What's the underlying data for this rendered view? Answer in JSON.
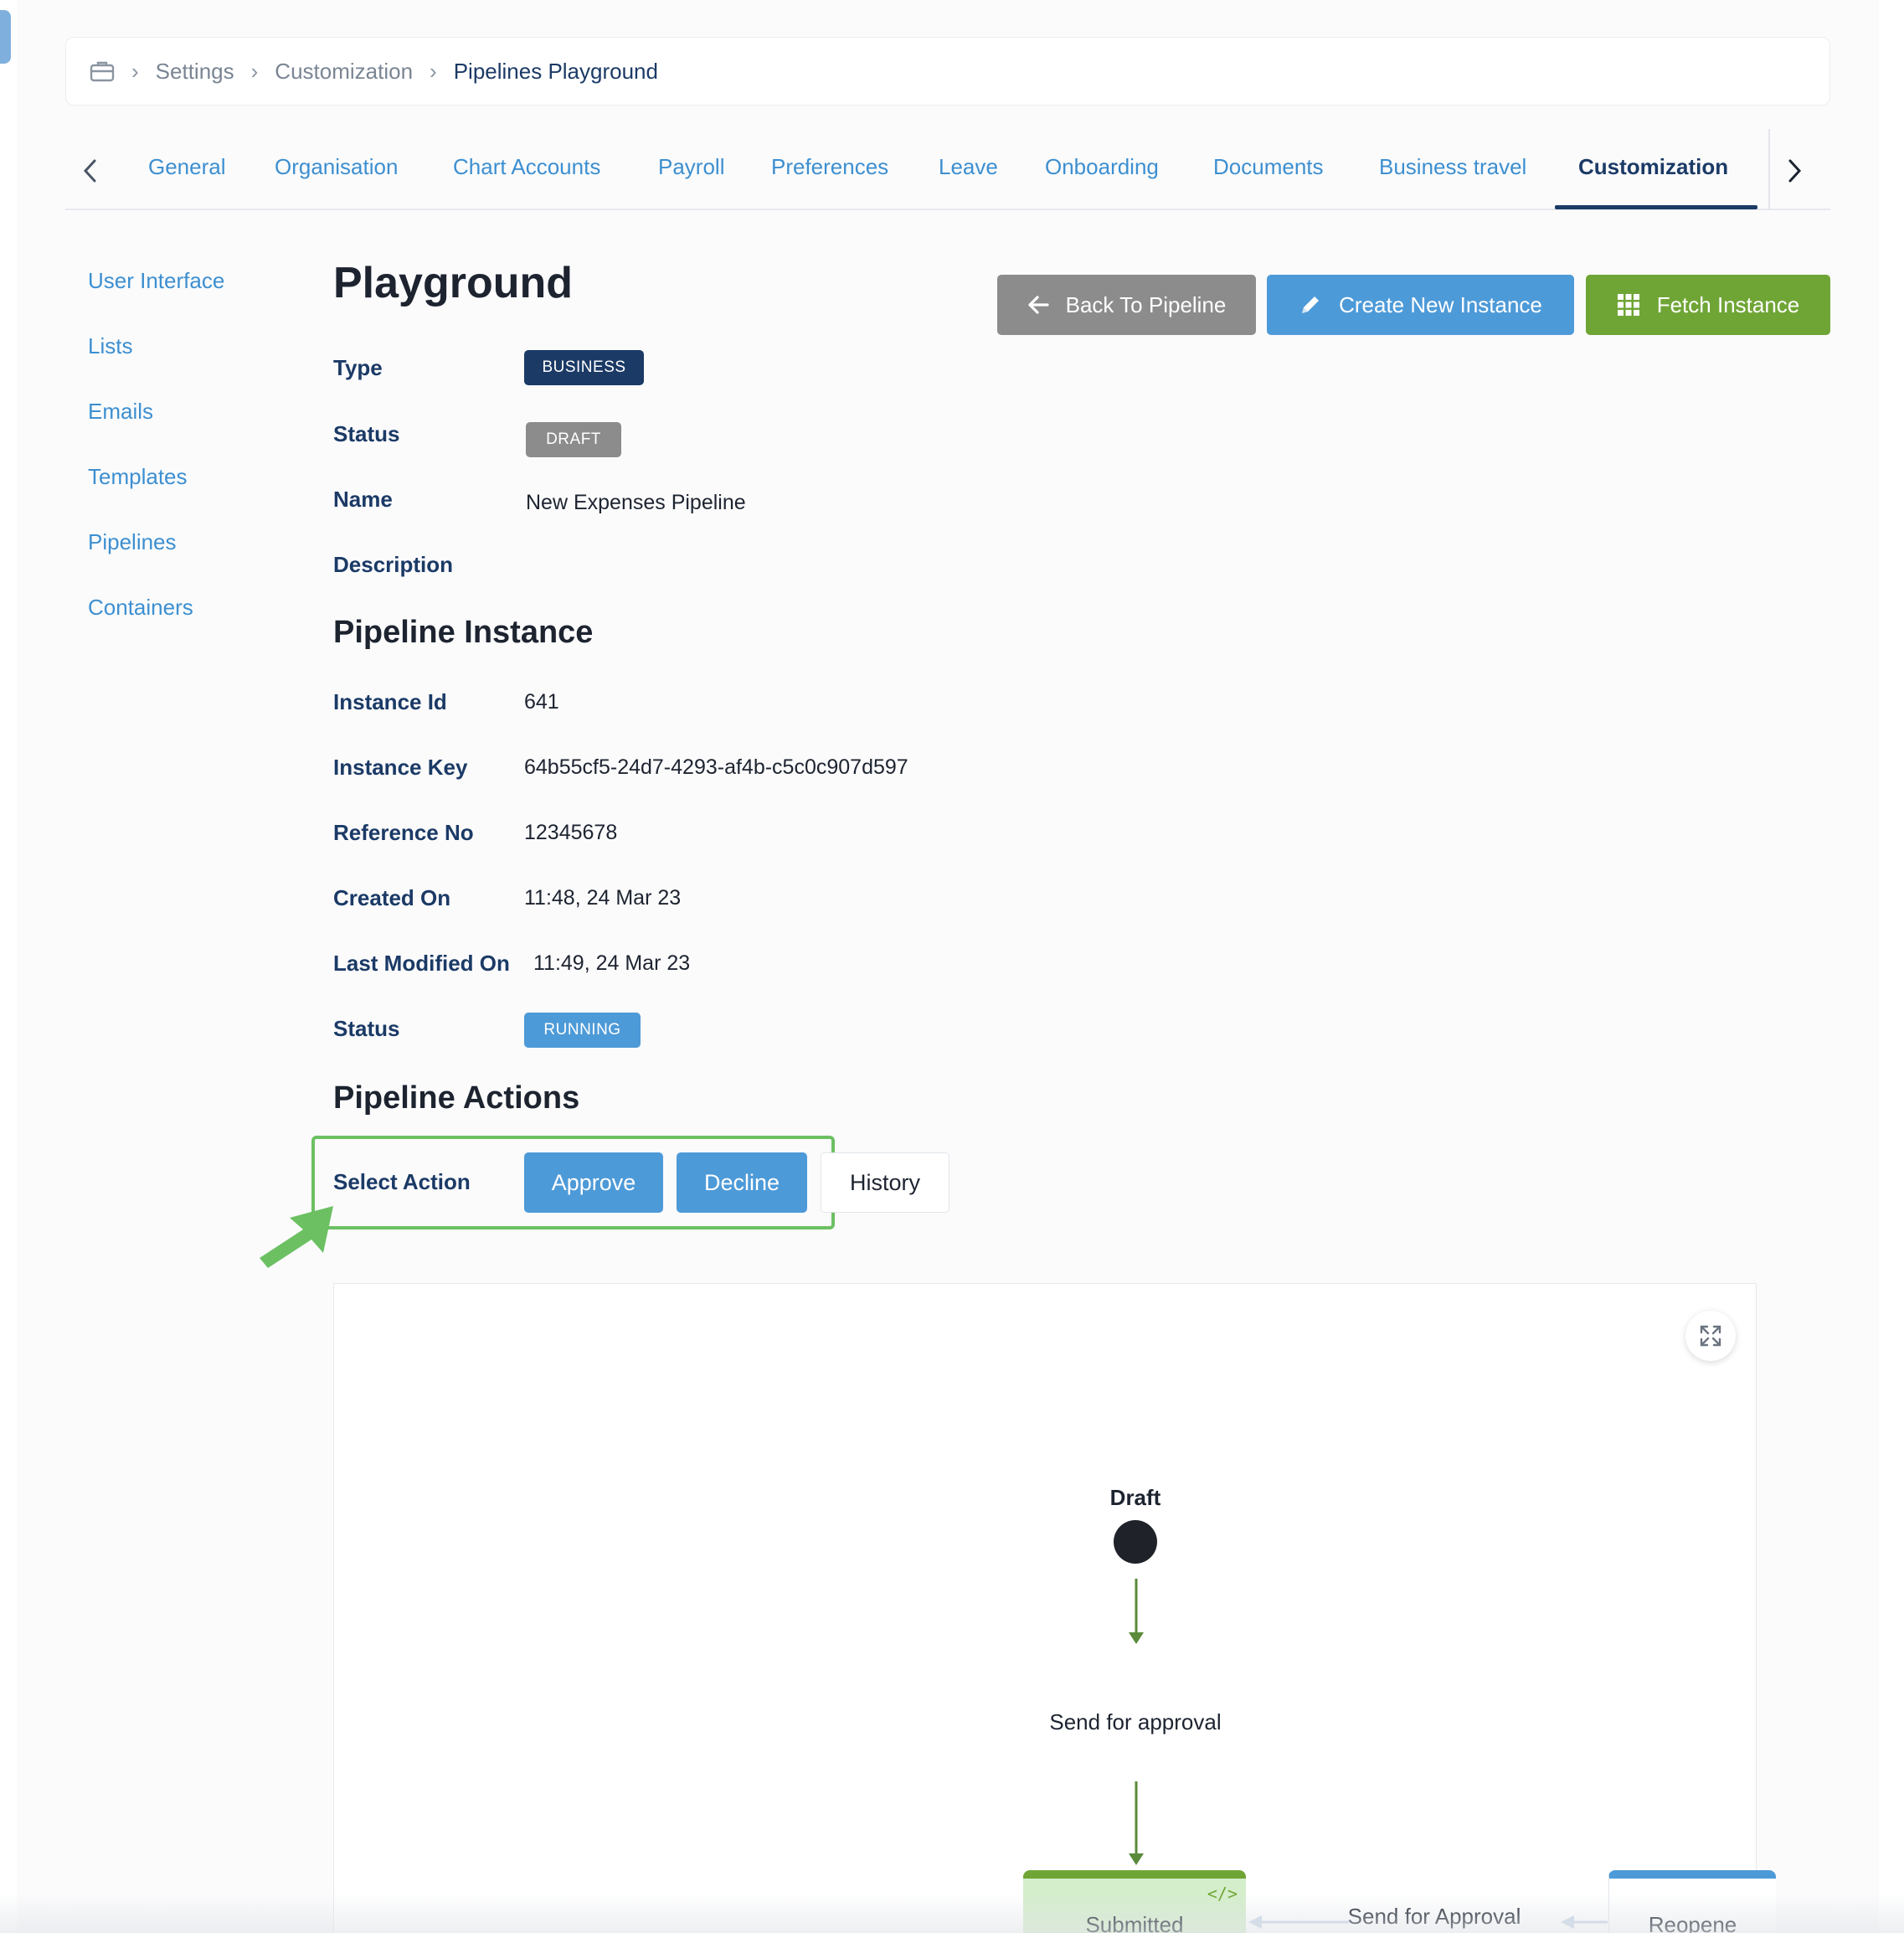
{
  "breadcrumb": {
    "items": [
      "Settings",
      "Customization"
    ],
    "current": "Pipelines Playground"
  },
  "tabs": [
    {
      "label": "General"
    },
    {
      "label": "Organisation"
    },
    {
      "label": "Chart Accounts"
    },
    {
      "label": "Payroll"
    },
    {
      "label": "Preferences"
    },
    {
      "label": "Leave"
    },
    {
      "label": "Onboarding"
    },
    {
      "label": "Documents"
    },
    {
      "label": "Business travel"
    },
    {
      "label": "Customization",
      "active": true
    }
  ],
  "sidebar": {
    "items": [
      {
        "label": "User Interface"
      },
      {
        "label": "Lists"
      },
      {
        "label": "Emails"
      },
      {
        "label": "Templates"
      },
      {
        "label": "Pipelines"
      },
      {
        "label": "Containers"
      }
    ]
  },
  "header": {
    "title": "Playground",
    "back_label": "Back To Pipeline",
    "create_label": "Create New Instance",
    "fetch_label": "Fetch Instance"
  },
  "pipeline": {
    "type_label": "Type",
    "type_value": "BUSINESS",
    "status_label": "Status",
    "status_value": "DRAFT",
    "name_label": "Name",
    "name_value": "New Expenses Pipeline",
    "description_label": "Description"
  },
  "instance": {
    "section_title": "Pipeline Instance",
    "id_label": "Instance Id",
    "id_value": "641",
    "key_label": "Instance Key",
    "key_value": "64b55cf5-24d7-4293-af4b-c5c0c907d597",
    "ref_label": "Reference No",
    "ref_value": "12345678",
    "created_label": "Created On",
    "created_value": "11:48, 24 Mar 23",
    "modified_label": "Last Modified On",
    "modified_value": "11:49, 24 Mar 23",
    "status_label": "Status",
    "status_value": "RUNNING"
  },
  "actions": {
    "section_title": "Pipeline Actions",
    "select_label": "Select Action",
    "approve_label": "Approve",
    "decline_label": "Decline",
    "history_label": "History"
  },
  "diagram": {
    "start_label": "Draft",
    "transition_1": "Send for approval",
    "state_submitted": "Submitted",
    "transition_2": "Send for Approval",
    "state_reopened": "Reopene"
  },
  "colors": {
    "primary": "#4d9ad8",
    "navy": "#1b3a66",
    "success": "#6fa535",
    "muted": "#8c8c8c",
    "highlight": "#6cc062"
  }
}
